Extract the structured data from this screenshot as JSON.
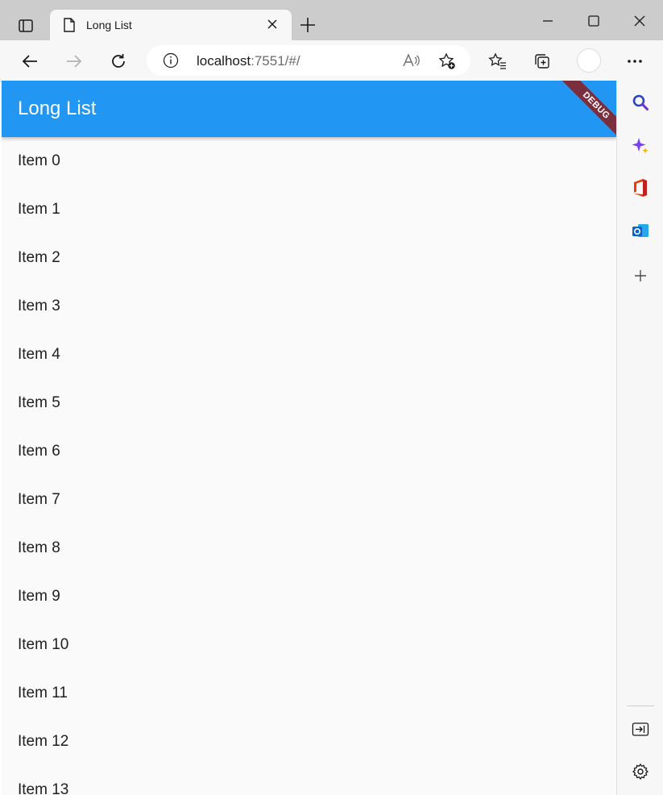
{
  "browser": {
    "tab_title": "Long List",
    "url_host": "localhost",
    "url_rest": ":7551/#/"
  },
  "app": {
    "title": "Long List",
    "debug_banner": "DEBUG",
    "appbar_color": "#2196f3",
    "items": [
      "Item 0",
      "Item 1",
      "Item 2",
      "Item 3",
      "Item 4",
      "Item 5",
      "Item 6",
      "Item 7",
      "Item 8",
      "Item 9",
      "Item 10",
      "Item 11",
      "Item 12",
      "Item 13"
    ]
  },
  "sidebar_icons": [
    "search-icon",
    "copilot-icon",
    "office-icon",
    "outlook-icon",
    "add-icon",
    "hide-sidebar-icon",
    "settings-icon"
  ]
}
